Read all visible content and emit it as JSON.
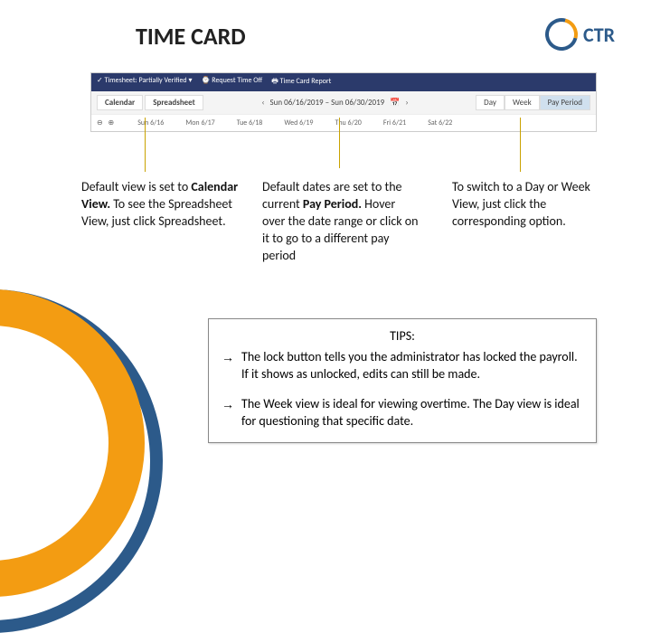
{
  "title": "TIME CARD",
  "logo_text": "CTR",
  "toolbar": {
    "row1": {
      "a": "✓ Timesheet: Partially Verified ▾",
      "b": "⌚ Request Time Off",
      "c": "🖶 Time Card Report"
    },
    "tabs": {
      "calendar": "Calendar",
      "spreadsheet": "Spreadsheet"
    },
    "date_prev": "‹",
    "date_range": "Sun 06/16/2019 – Sun 06/30/2019",
    "date_next": "›",
    "views": {
      "day": "Day",
      "week": "Week",
      "payperiod": "Pay Period"
    },
    "row3": {
      "zoom": "⊖  ⊕",
      "d1": "Sun 6/16",
      "d2": "Mon 6/17",
      "d3": "Tue 6/18",
      "d4": "Wed 6/19",
      "d5": "Thu 6/20",
      "d6": "Fri 6/21",
      "d7": "Sat 6/22"
    }
  },
  "para1": {
    "t1": "Default view is set to ",
    "b1": "Calendar View.",
    "t2": " To see the Spreadsheet View, just click Spreadsheet."
  },
  "para2": {
    "t1": "Default dates are set to the current ",
    "b1": "Pay Period.",
    "t2": " Hover over the date range or click on it to go to a different pay period"
  },
  "para3": {
    "t1": "To switch to a Day or Week View, just click the corresponding option."
  },
  "tips": {
    "title": "TIPS:",
    "arrow": "→",
    "tip1": "The lock button tells you the administrator has locked the payroll. If it shows as unlocked, edits can still be made.",
    "tip2": "The Week view is ideal for viewing overtime. The Day view is ideal for questioning that specific date."
  }
}
